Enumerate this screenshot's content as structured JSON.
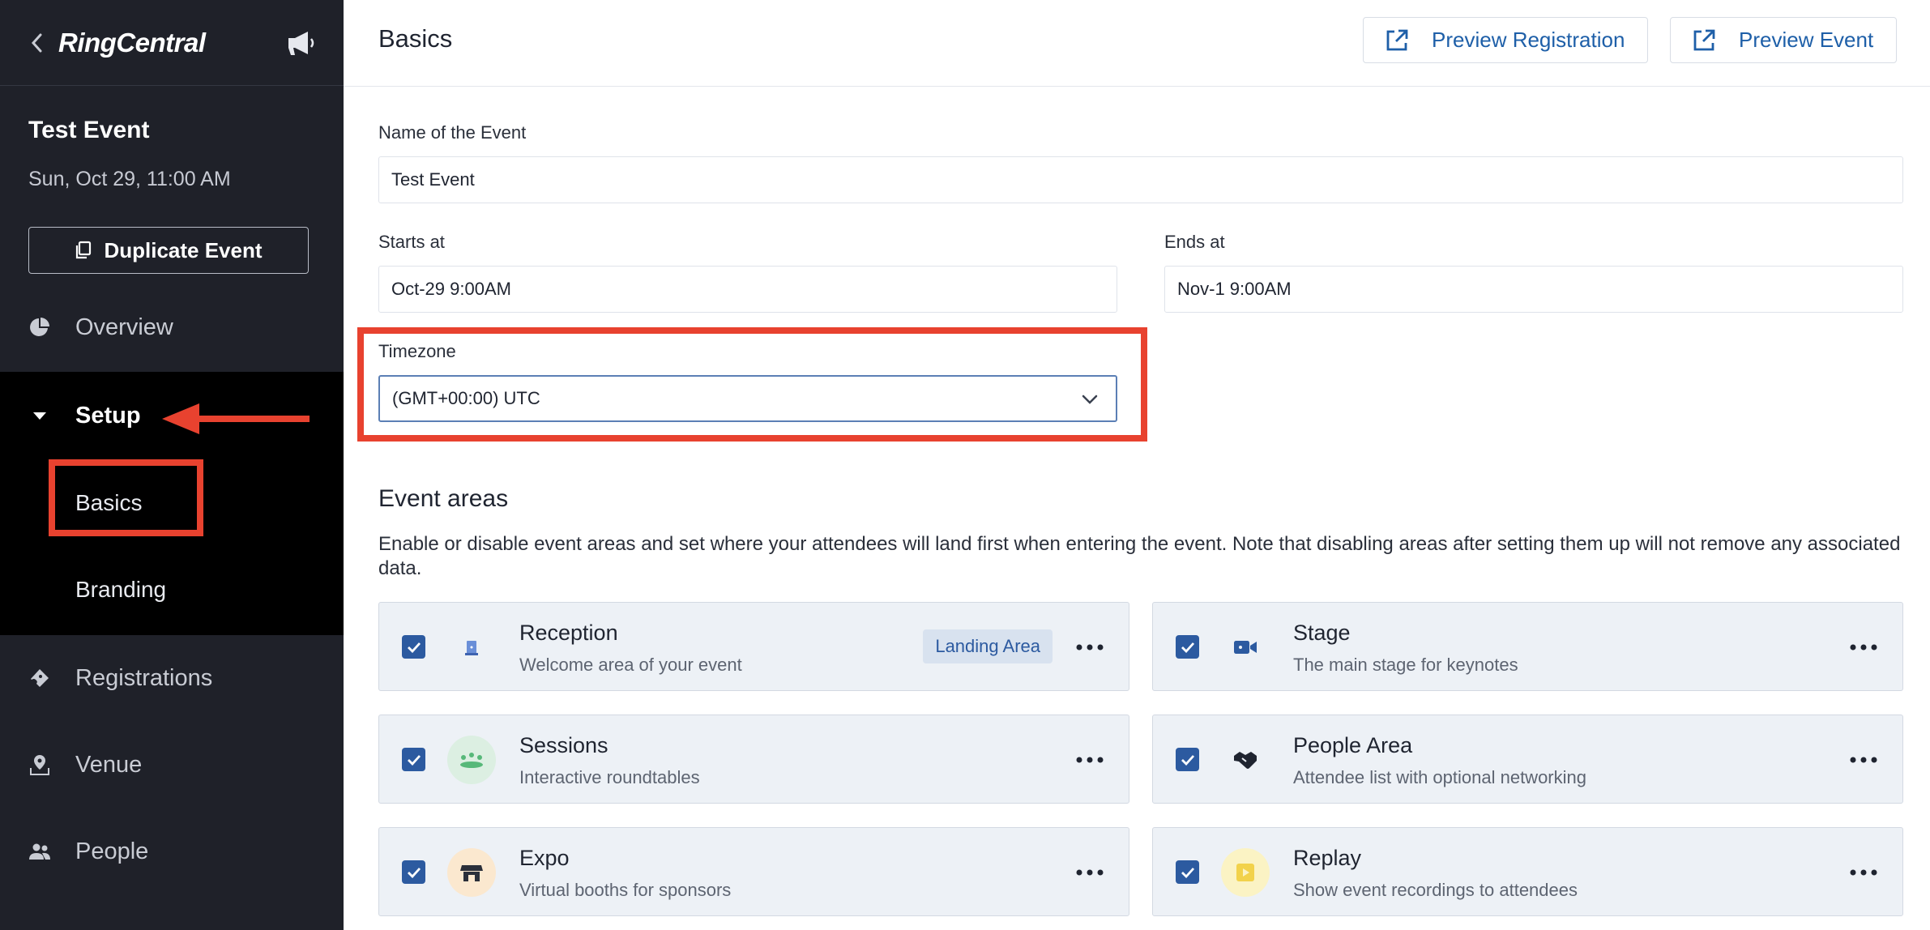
{
  "sidebar": {
    "logo": "RingCentral",
    "event_title": "Test Event",
    "event_date": "Sun, Oct 29, 11:00 AM",
    "duplicate_label": "Duplicate Event",
    "nav": {
      "overview": "Overview",
      "setup": "Setup",
      "basics": "Basics",
      "branding": "Branding",
      "registrations": "Registrations",
      "venue": "Venue",
      "people": "People"
    }
  },
  "header": {
    "title": "Basics",
    "preview_registration": "Preview Registration",
    "preview_event": "Preview Event"
  },
  "form": {
    "name_label": "Name of the Event",
    "name_value": "Test Event",
    "starts_label": "Starts at",
    "starts_value": "Oct-29 9:00AM",
    "ends_label": "Ends at",
    "ends_value": "Nov-1 9:00AM",
    "timezone_label": "Timezone",
    "timezone_value": "(GMT+00:00) UTC"
  },
  "event_areas": {
    "title": "Event areas",
    "description": "Enable or disable event areas and set where your attendees will land first when entering the event. Note that disabling areas after setting them up will not remove any associated data.",
    "areas": [
      {
        "name": "Reception",
        "desc": "Welcome area of your event",
        "badge": "Landing Area",
        "icon": "reception-icon",
        "enabled": true
      },
      {
        "name": "Stage",
        "desc": "The main stage for keynotes",
        "icon": "video-camera-icon",
        "enabled": true
      },
      {
        "name": "Sessions",
        "desc": "Interactive roundtables",
        "icon": "roundtable-icon",
        "enabled": true
      },
      {
        "name": "People Area",
        "desc": "Attendee list with optional networking",
        "icon": "handshake-icon",
        "enabled": true
      },
      {
        "name": "Expo",
        "desc": "Virtual booths for sponsors",
        "icon": "booth-icon",
        "enabled": true
      },
      {
        "name": "Replay",
        "desc": "Show event recordings to attendees",
        "icon": "replay-icon",
        "enabled": true
      }
    ]
  },
  "colors": {
    "sidebar_bg": "#1f2129",
    "setup_bg": "#000000",
    "accent": "#2c5aa0",
    "annotation_red": "#e8422f"
  }
}
